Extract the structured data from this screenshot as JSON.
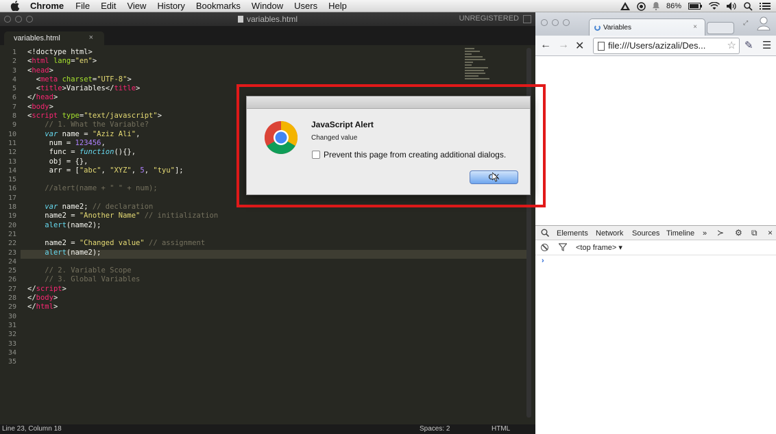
{
  "menubar": {
    "app_name": "Chrome",
    "items": [
      "File",
      "Edit",
      "View",
      "History",
      "Bookmarks",
      "Window",
      "Users",
      "Help"
    ],
    "battery": "86%"
  },
  "editor": {
    "window_title": "variables.html",
    "unregistered": "UNREGISTERED",
    "tab_label": "variables.html",
    "tab_close": "×",
    "line_count": 35,
    "status": {
      "position": "Line 23, Column 18",
      "spaces": "Spaces: 2",
      "syntax": "HTML"
    }
  },
  "alert": {
    "title": "JavaScript Alert",
    "message": "Changed value",
    "checkbox_label": "Prevent this page from creating additional dialogs.",
    "ok_label": "OK"
  },
  "browser": {
    "tab_title": "Variables",
    "tab_close": "×",
    "url": "file:///Users/azizali/Des...",
    "devtools": {
      "tabs": [
        "Elements",
        "Network",
        "Sources",
        "Timeline"
      ],
      "more": "»",
      "frame_selector": "<top frame> ▾",
      "prompt": "›"
    }
  },
  "colors": {
    "editor_bg": "#272822",
    "keyword": "#66d9ef",
    "tag": "#f92672",
    "string": "#e6db74",
    "comment": "#75715e",
    "number": "#ae81ff",
    "highlight_box": "#e21a1a"
  }
}
